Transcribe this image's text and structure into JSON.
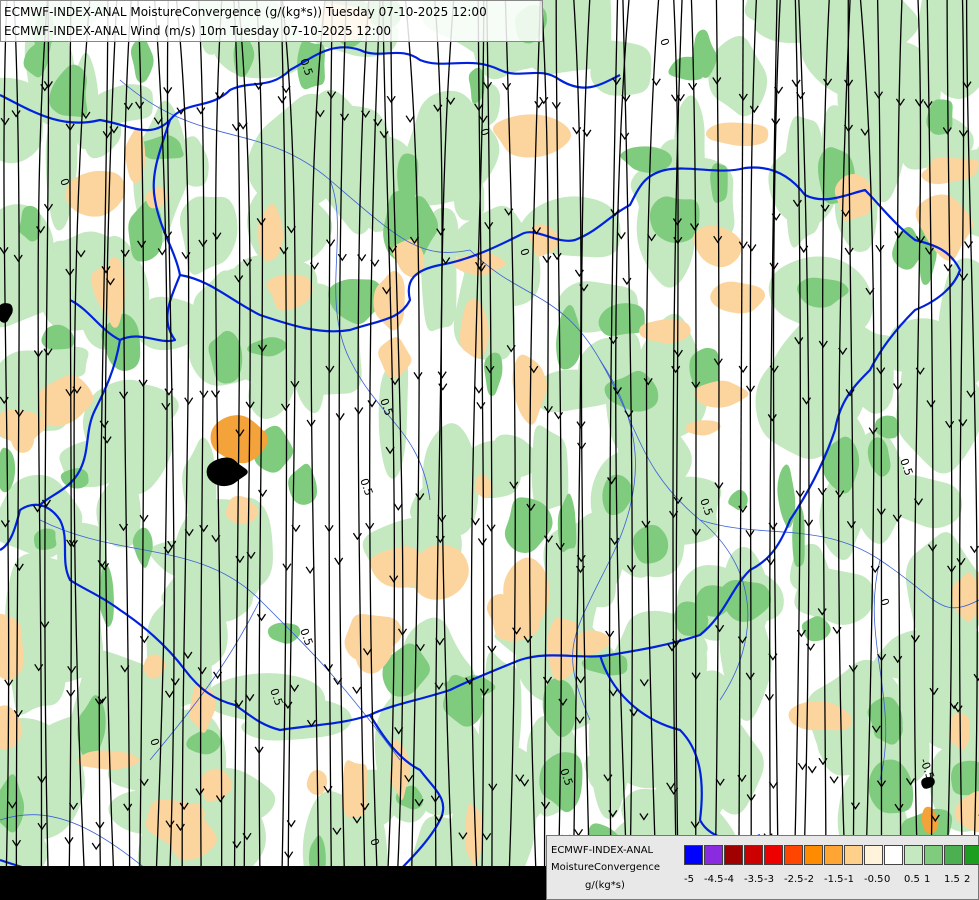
{
  "titles": {
    "line1": "ECMWF-INDEX-ANAL MoistureConvergence (g/(kg*s)) Tuesday 07-10-2025 12:00",
    "line2": "ECMWF-INDEX-ANAL Wind (m/s) 10m Tuesday 07-10-2025 12:00"
  },
  "legend": {
    "name_line1": "ECMWF-INDEX-ANAL",
    "name_line2": "MoistureConvergence",
    "units": "g/(kg*s)",
    "colors": [
      "#0000ff",
      "#8a2be2",
      "#a00000",
      "#cc0000",
      "#ee0000",
      "#ff4500",
      "#ff8c00",
      "#ffa533",
      "#ffd089",
      "#fff3dc",
      "#ffffff",
      "#c4e8c0",
      "#80cc7e",
      "#4caf50",
      "#1e9e1e",
      "#009000"
    ],
    "ticks": [
      "-5",
      "-4.5",
      "-4",
      "-3.5",
      "-3",
      "-2.5",
      "-2",
      "-1.5",
      "-1",
      "-0.5",
      "0",
      "0.5",
      "1",
      "1.5",
      "2"
    ]
  },
  "map": {
    "fill_colors": {
      "green_light": "#c4e8c0",
      "green_mid": "#80cc7e",
      "green_dark": "#2f9e3a",
      "orange_light": "#fbd59d",
      "orange_mid": "#f4a23a",
      "black": "#000000"
    },
    "border_color": "#0022dd",
    "river_color": "#3a5fd8",
    "streamline_color": "#000000",
    "contour_labels": [
      "0",
      "0.5",
      "0",
      "0.5",
      "0",
      "0.5",
      "0",
      "0.5",
      "0",
      "0.5",
      "0",
      "0.5",
      "0",
      "0.5",
      "-0.5",
      "0.5"
    ]
  }
}
